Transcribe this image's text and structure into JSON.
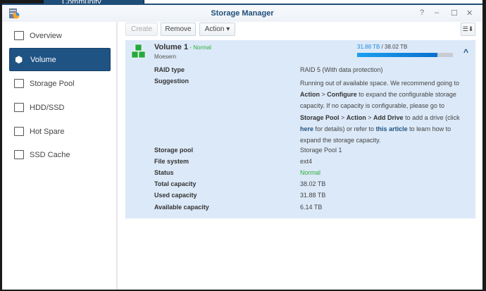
{
  "background": {
    "partial_label": "Community"
  },
  "window": {
    "title": "Storage Manager",
    "controls": [
      "?",
      "–",
      "☐",
      "✕"
    ]
  },
  "sidebar": {
    "items": [
      {
        "label": "Overview",
        "icon": "overview-icon"
      },
      {
        "label": "Volume",
        "icon": "volume-icon",
        "selected": true
      },
      {
        "label": "Storage Pool",
        "icon": "storage-pool-icon"
      },
      {
        "label": "HDD/SSD",
        "icon": "hdd-icon"
      },
      {
        "label": "Hot Spare",
        "icon": "hot-spare-icon"
      },
      {
        "label": "SSD Cache",
        "icon": "ssd-cache-icon"
      }
    ]
  },
  "toolbar": {
    "create": "Create",
    "remove": "Remove",
    "action": "Action ▾",
    "sort_icon": "☰⬇"
  },
  "volume": {
    "name": "Volume 1",
    "status_sep": " - ",
    "status": "Normal",
    "description": "Moesern",
    "used": "31.88 TB",
    "total": " / 38.02 TB",
    "usage_fraction": 0.838,
    "collapse": "^",
    "details": {
      "raid_label": "RAID type",
      "raid_value": "RAID 5 (With data protection)",
      "suggestion_label": "Suggestion",
      "suggestion": {
        "p1": "Running out of available space. We recommend going to",
        "p2a": "Action",
        "p2b": " > ",
        "p2c": "Configure",
        "p2d": " to expand the configurable storage",
        "p3": "capacity. If no capacity is configurable, please go to",
        "p4a": "Storage Pool",
        "p4b": " > ",
        "p4c": "Action",
        "p4d": " > ",
        "p4e": "Add Drive",
        "p4f": " to add a drive (click",
        "p5a": "here",
        "p5b": " for details) or refer to ",
        "p5c": "this article",
        "p5d": " to learn how to",
        "p6": "expand the storage capacity."
      },
      "pool_label": "Storage pool",
      "pool_value": "Storage Pool 1",
      "fs_label": "File system",
      "fs_value": "ext4",
      "status_label": "Status",
      "status_value": "Normal",
      "total_label": "Total capacity",
      "total_value": "38.02 TB",
      "used_label": "Used capacity",
      "used_value": "31.88 TB",
      "avail_label": "Available capacity",
      "avail_value": "6.14 TB"
    }
  },
  "colors": {
    "accent": "#1f5383",
    "green": "#2eae3e",
    "bar": "#1a8be0"
  }
}
